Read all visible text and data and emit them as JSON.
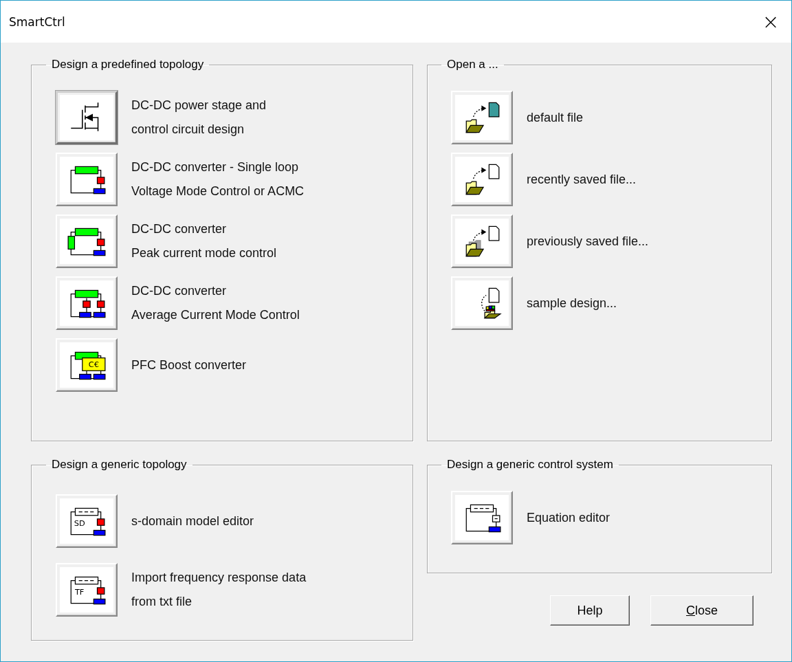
{
  "window": {
    "title": "SmartCtrl",
    "close": "×"
  },
  "left_column": [
    {
      "title": "Design a predefined topology",
      "items": [
        {
          "kind": "mosfet",
          "lines": [
            "DC-DC power stage and",
            "control circuit design"
          ],
          "selected": true
        },
        {
          "kind": "single-loop",
          "lines": [
            "DC-DC converter - Single loop",
            "Voltage Mode Control or ACMC"
          ],
          "selected": false
        },
        {
          "kind": "peak",
          "lines": [
            "DC-DC converter",
            "Peak current mode control"
          ],
          "selected": false
        },
        {
          "kind": "average",
          "lines": [
            "DC-DC converter",
            "Average Current Mode Control"
          ],
          "selected": false
        },
        {
          "kind": "pfc",
          "icon_text": "C€",
          "lines": [
            "PFC Boost converter"
          ],
          "selected": false
        }
      ]
    },
    {
      "title": "Design a generic topology",
      "items": [
        {
          "kind": "block",
          "icon_text": "SD",
          "lines": [
            "s-domain model editor"
          ],
          "selected": false
        },
        {
          "kind": "block",
          "icon_text": "TF",
          "lines": [
            "Import frequency response data",
            "from txt file"
          ],
          "selected": false
        }
      ]
    }
  ],
  "right_column": [
    {
      "title": "Open a ...",
      "items": [
        {
          "kind": "open-default",
          "lines": [
            "default file"
          ],
          "selected": false
        },
        {
          "kind": "open-recent",
          "lines": [
            "recently saved file..."
          ],
          "selected": false
        },
        {
          "kind": "open-previous",
          "lines": [
            "previously saved file..."
          ],
          "selected": false
        },
        {
          "kind": "sample",
          "lines": [
            "sample design..."
          ],
          "selected": false
        }
      ]
    },
    {
      "title": "Design a generic control system",
      "items": [
        {
          "kind": "equation",
          "lines": [
            "Equation editor"
          ],
          "selected": false
        }
      ]
    }
  ],
  "buttons": [
    {
      "label": "Help",
      "underline_first": false
    },
    {
      "label": "Close",
      "underline_first": true
    }
  ]
}
